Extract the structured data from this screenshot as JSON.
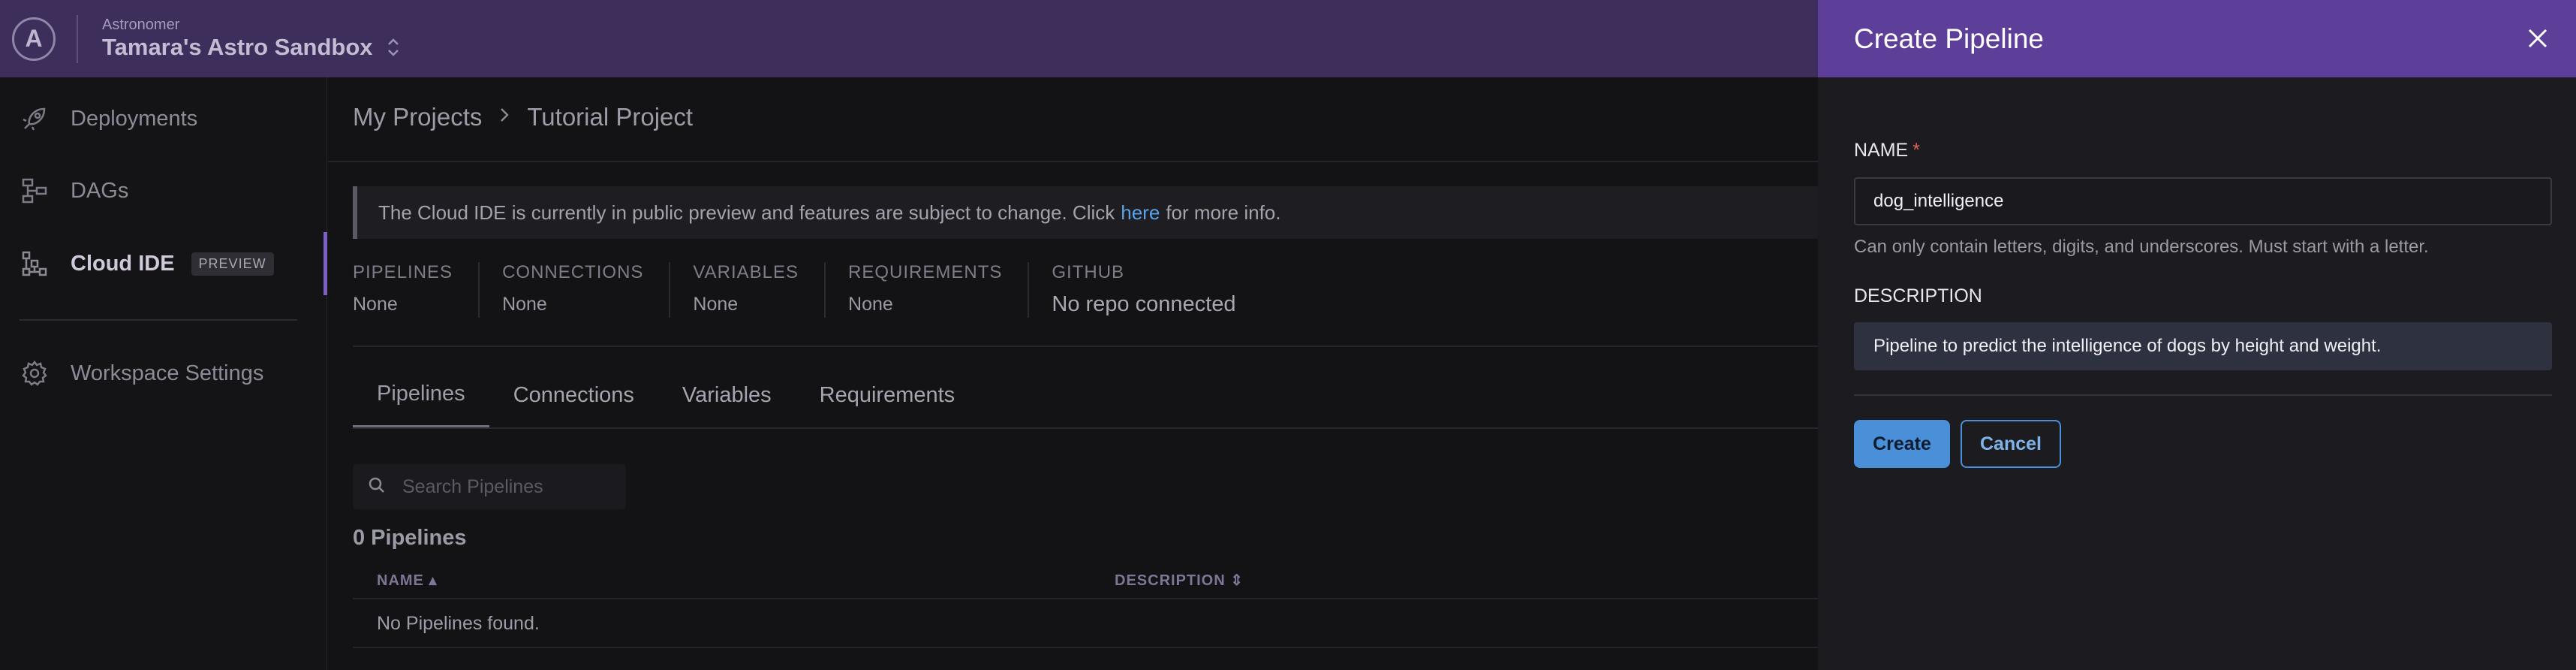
{
  "topbar": {
    "org_caption": "Astronomer",
    "workspace_name": "Tamara's Astro Sandbox"
  },
  "sidebar": {
    "items": [
      {
        "label": "Deployments",
        "icon": "rocket-icon"
      },
      {
        "label": "DAGs",
        "icon": "dag-icon"
      },
      {
        "label": "Cloud IDE",
        "icon": "cloud-ide-icon",
        "badge": "PREVIEW",
        "active": true
      },
      {
        "label": "Workspace Settings",
        "icon": "gear-icon"
      }
    ]
  },
  "breadcrumb": {
    "root": "My Projects",
    "current": "Tutorial Project"
  },
  "banner": {
    "text_before": "The Cloud IDE is currently in public preview and features are subject to change. Click",
    "link": "here",
    "text_after": "for more info."
  },
  "stats": [
    {
      "label": "PIPELINES",
      "value": "None"
    },
    {
      "label": "CONNECTIONS",
      "value": "None"
    },
    {
      "label": "VARIABLES",
      "value": "None"
    },
    {
      "label": "REQUIREMENTS",
      "value": "None"
    },
    {
      "label": "GITHUB",
      "value": "No repo connected"
    }
  ],
  "tabs": [
    {
      "label": "Pipelines",
      "active": true
    },
    {
      "label": "Connections"
    },
    {
      "label": "Variables"
    },
    {
      "label": "Requirements"
    }
  ],
  "search": {
    "placeholder": "Search Pipelines"
  },
  "list": {
    "count_label": "0 Pipelines",
    "columns": [
      "NAME ▴",
      "DESCRIPTION ⇕"
    ],
    "empty_text": "No Pipelines found."
  },
  "panel": {
    "title": "Create Pipeline",
    "name_label": "NAME",
    "required_mark": "*",
    "name_value": "dog_intelligence",
    "name_hint": "Can only contain letters, digits, and underscores. Must start with a letter.",
    "description_label": "DESCRIPTION",
    "description_value": "Pipeline to predict the intelligence of dogs by height and weight.",
    "create_label": "Create",
    "cancel_label": "Cancel"
  },
  "colors": {
    "topbar": "#3e2e5c",
    "panel_header": "#5d3f9a",
    "primary_button": "#4a90d9",
    "link": "#5aa1e6"
  }
}
